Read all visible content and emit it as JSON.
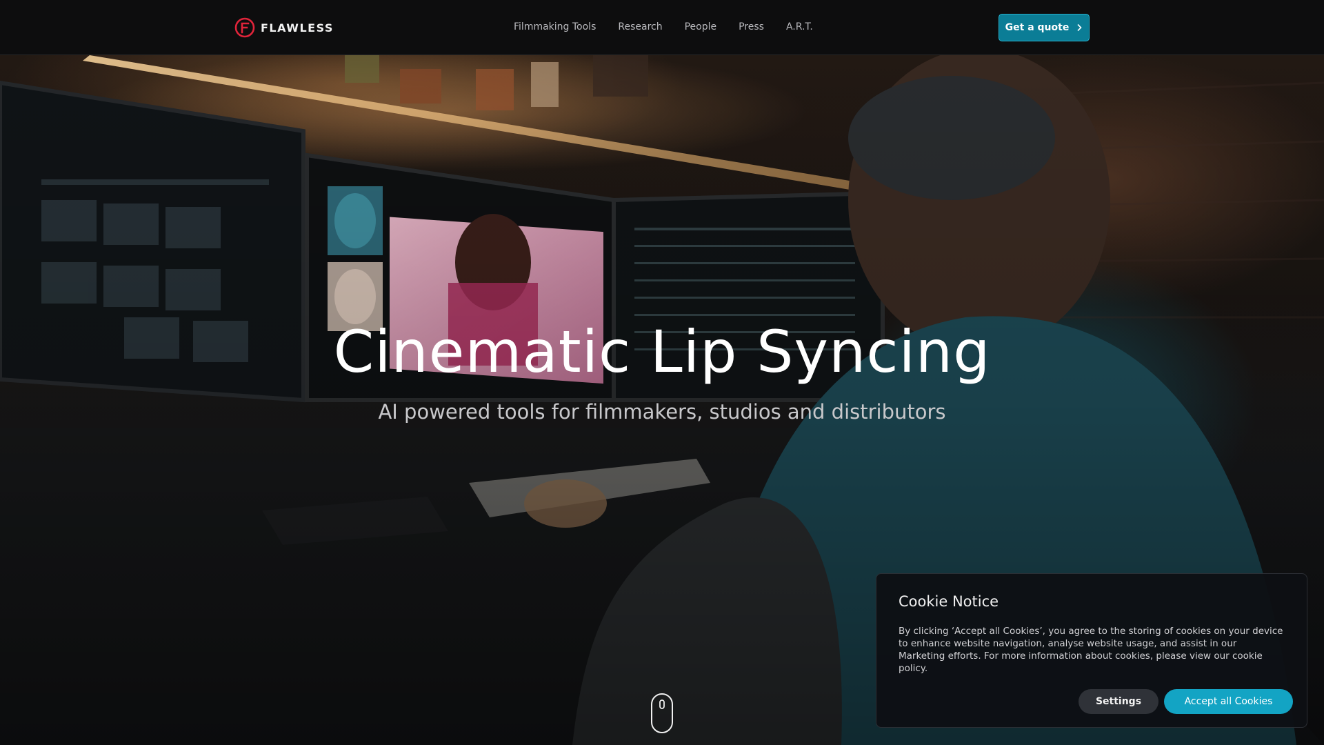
{
  "header": {
    "brand_name": "FLAWLESS",
    "nav": [
      {
        "label": "Filmmaking Tools"
      },
      {
        "label": "Research"
      },
      {
        "label": "People"
      },
      {
        "label": "Press"
      },
      {
        "label": "A.R.T."
      }
    ],
    "cta_label": "Get a quote"
  },
  "hero": {
    "title": "Cinematic Lip Syncing",
    "subtitle": "AI powered tools for filmmakers, studios and distributors",
    "scroll_icon": "mouse-scroll-icon"
  },
  "cookie": {
    "title": "Cookie Notice",
    "text": "By clicking ‘Accept all Cookies’, you agree to the storing of cookies on your device to enhance website navigation, analyse website usage, and assist in our Marketing efforts. For more information about cookies, please view our cookie policy.",
    "settings_label": "Settings",
    "accept_label": "Accept all Cookies"
  },
  "colors": {
    "accent": "#13a4c4",
    "cta_background": "#0b7d96",
    "logo_red": "#e0243a",
    "header_background": "#0d0d0e"
  }
}
